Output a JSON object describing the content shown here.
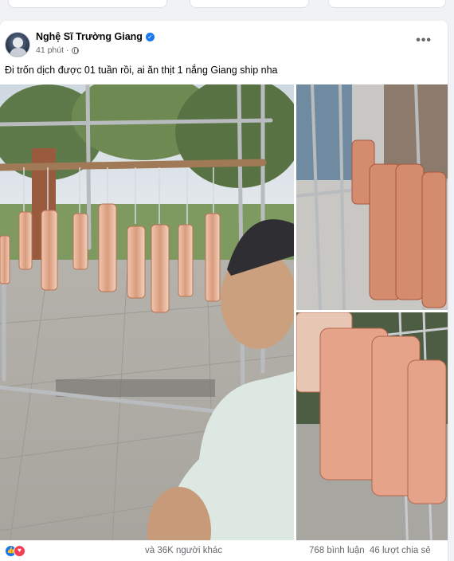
{
  "post": {
    "author": "Nghệ Sĩ Trường Giang",
    "time": "41 phút",
    "caption": "Đi trốn dịch được 01 tuần rồi, ai ăn thịt 1 nắng Giang ship nha",
    "menu_icon": "more-dots-icon"
  },
  "stats": {
    "reactions_text": "và 36K người khác",
    "comments": "768 bình luận",
    "shares": "46 lượt chia sẻ",
    "reaction_icons": [
      "like-icon",
      "love-icon"
    ]
  },
  "photos": [
    {
      "name": "drying-pork-rack-selfie"
    },
    {
      "name": "pork-strips-closeup-top"
    },
    {
      "name": "pork-strips-closeup-bottom"
    }
  ],
  "colors": {
    "accent": "#1877f2",
    "love": "#f33e58",
    "text_secondary": "#65676b"
  }
}
